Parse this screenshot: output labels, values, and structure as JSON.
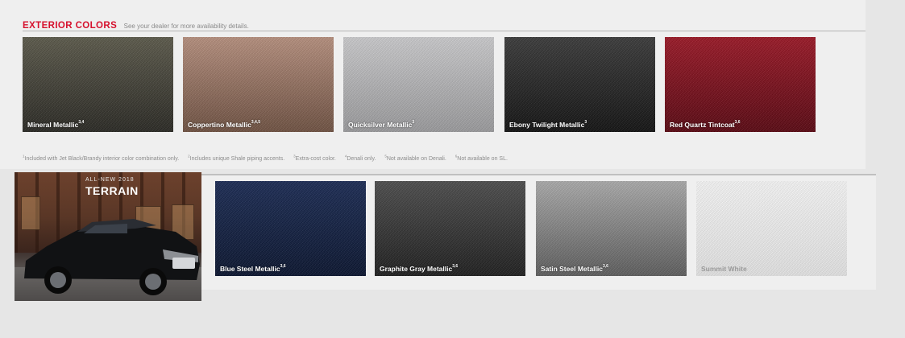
{
  "header": {
    "title": "EXTERIOR COLORS",
    "subtitle": "See your dealer for more availability details."
  },
  "swatches_row1": [
    {
      "name": "Mineral Metallic",
      "notes": "3,4",
      "color_top": "#5c5a4c",
      "color_bottom": "#2b2a25"
    },
    {
      "name": "Coppertino Metallic",
      "notes": "3,4,5",
      "color_top": "#b58f7e",
      "color_bottom": "#6f5243"
    },
    {
      "name": "Quicksilver Metallic",
      "notes": "3",
      "color_top": "#c9c9cb",
      "color_bottom": "#9a9a9c"
    },
    {
      "name": "Ebony Twilight Metallic",
      "notes": "3",
      "color_top": "#3c3c3c",
      "color_bottom": "#141414"
    },
    {
      "name": "Red Quartz Tintcoat",
      "notes": "3,6",
      "color_top": "#9a1a28",
      "color_bottom": "#5a0a14"
    }
  ],
  "footnotes": [
    {
      "num": "1",
      "text": "Included with Jet Black/Brandy interior color combination only."
    },
    {
      "num": "2",
      "text": "Includes unique Shale piping accents."
    },
    {
      "num": "3",
      "text": "Extra-cost color."
    },
    {
      "num": "4",
      "text": "Denali only."
    },
    {
      "num": "5",
      "text": "Not available on Denali."
    },
    {
      "num": "6",
      "text": "Not available on SL."
    }
  ],
  "promo": {
    "kicker": "ALL-NEW 2018",
    "model": "TERRAIN"
  },
  "swatches_row2": [
    {
      "name": "Blue Steel Metallic",
      "notes": "3,6",
      "color_top": "#1d2d55",
      "color_bottom": "#0c1630"
    },
    {
      "name": "Graphite Gray Metallic",
      "notes": "3,6",
      "color_top": "#4e4e4e",
      "color_bottom": "#202020"
    },
    {
      "name": "Satin Steel Metallic",
      "notes": "3,6",
      "color_top": "#a9a9a9",
      "color_bottom": "#5e5e5e"
    },
    {
      "name": "Summit White",
      "notes": "",
      "color_top": "#f4f4f4",
      "color_bottom": "#e2e2e2"
    }
  ]
}
